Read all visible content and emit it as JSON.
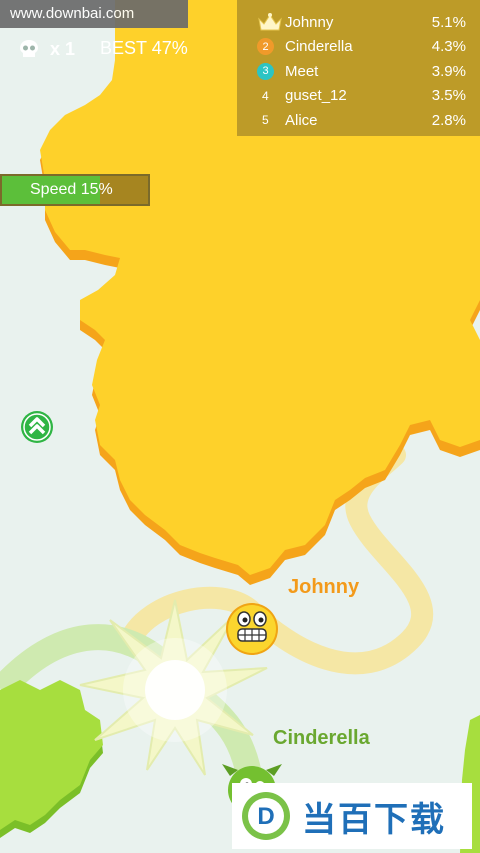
{
  "watermark": {
    "url": "www.downbai.com",
    "brand": "当百下载",
    "brand_mark": "D"
  },
  "hud": {
    "kills_label": "x 1",
    "best_label": "BEST 47%"
  },
  "leaderboard": [
    {
      "rank": "1",
      "rank_icon": "crown-icon",
      "name": "Johnny",
      "score": "5.1%"
    },
    {
      "rank": "2",
      "rank_icon": "orange-badge",
      "name": "Cinderella",
      "score": "4.3%"
    },
    {
      "rank": "3",
      "rank_icon": "teal-badge",
      "name": "Meet",
      "score": "3.9%"
    },
    {
      "rank": "4",
      "rank_icon": "",
      "name": "guset_12",
      "score": "3.5%"
    },
    {
      "rank": "5",
      "rank_icon": "",
      "name": "Alice",
      "score": "2.8%"
    }
  ],
  "speed": {
    "label": "Speed 15%",
    "level": 0.67
  },
  "players": {
    "johnny": {
      "label": "Johnny",
      "color": "#f39a1a"
    },
    "cinderella": {
      "label": "Cinderella",
      "color": "#6aa830"
    }
  },
  "colors": {
    "background": "#e9f2ee",
    "yellow_territory": "#fed12a",
    "yellow_edge": "#f5a41a",
    "green_territory": "#a7de3e",
    "green_edge": "#7bbf28",
    "johnny_trail": "#f6e6a0",
    "cinderella_trail": "#cfeab0",
    "boost": "#2fb544"
  },
  "icons": {
    "kills": "skull-icon",
    "boost": "double-chevron-up-icon",
    "explosion": "starburst-explosion"
  }
}
